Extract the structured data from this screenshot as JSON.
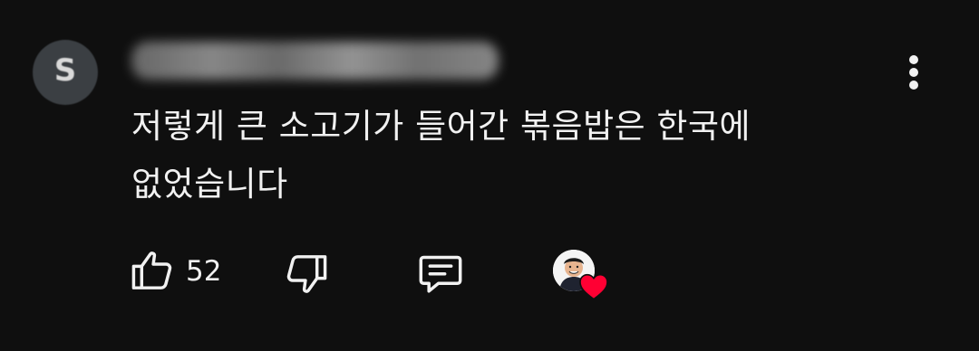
{
  "comment": {
    "author_initial": "S",
    "text": "저렇게 큰 소고기가 들어간 볶음밥은 한국에\n없었습니다",
    "like_count": "52"
  },
  "colors": {
    "background": "#0f0f0f",
    "text": "#f1f1f1",
    "heart": "#ff0033"
  },
  "icons": {
    "more": "more-vertical-icon",
    "like": "thumbs-up-icon",
    "dislike": "thumbs-down-icon",
    "reply": "reply-comment-icon",
    "creator_heart": "heart-icon"
  }
}
